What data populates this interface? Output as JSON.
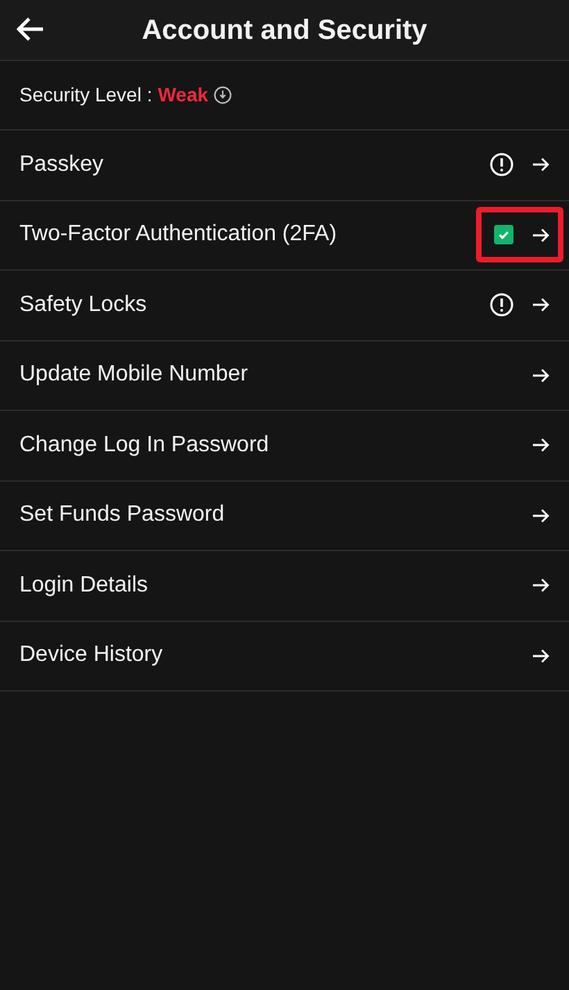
{
  "header": {
    "title": "Account and Security"
  },
  "security": {
    "label": "Security Level :",
    "value": "Weak"
  },
  "items": [
    {
      "label": "Passkey",
      "kind": "warning",
      "highlighted": false
    },
    {
      "label": "Two-Factor Authentication (2FA)",
      "kind": "enabled",
      "highlighted": true
    },
    {
      "label": "Safety Locks",
      "kind": "warning",
      "highlighted": false
    },
    {
      "label": "Update Mobile Number",
      "kind": "plain",
      "highlighted": false
    },
    {
      "label": "Change Log In Password",
      "kind": "plain",
      "highlighted": false
    },
    {
      "label": "Set Funds Password",
      "kind": "plain",
      "highlighted": false
    },
    {
      "label": "Login Details",
      "kind": "plain",
      "highlighted": false
    },
    {
      "label": "Device History",
      "kind": "plain",
      "highlighted": false
    }
  ]
}
